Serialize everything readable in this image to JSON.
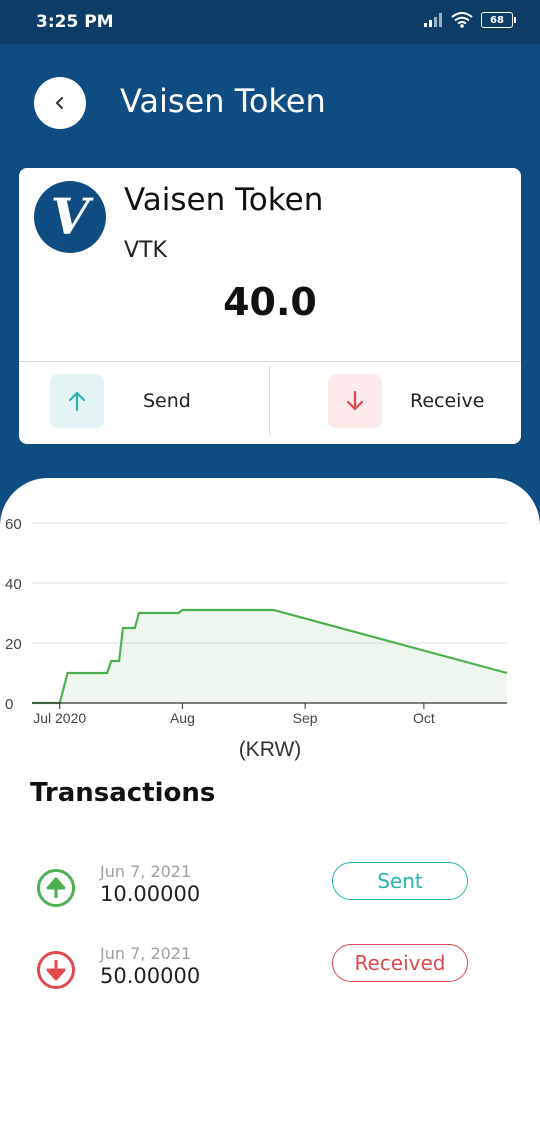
{
  "status_bar": {
    "time": "3:25 PM",
    "battery": "68"
  },
  "header": {
    "title": "Vaisen Token"
  },
  "token": {
    "logo_letter": "V",
    "name": "Vaisen Token",
    "symbol": "VTK",
    "balance": "40.0"
  },
  "actions": {
    "send_label": "Send",
    "receive_label": "Receive"
  },
  "colors": {
    "header_bg": "#0f4c81",
    "send_accent": "#26b5b0",
    "receive_accent": "#e0494f",
    "line": "#4caf50"
  },
  "chart_data": {
    "type": "area",
    "x": [
      "2020-06-24",
      "2020-07-01",
      "2020-07-03",
      "2020-07-05",
      "2020-07-13",
      "2020-07-14",
      "2020-07-16",
      "2020-07-17",
      "2020-07-20",
      "2020-07-21",
      "2020-07-31",
      "2020-08-01",
      "2020-08-24",
      "2020-10-22"
    ],
    "values": [
      0,
      0,
      10,
      10,
      10,
      14,
      14,
      25,
      25,
      30,
      30,
      31,
      31,
      10
    ],
    "xlim": [
      "2020-06-24",
      "2020-10-22"
    ],
    "x_ticks": [
      "Jul 2020",
      "Aug",
      "Sep",
      "Oct"
    ],
    "x_tick_dates": [
      "2020-07-01",
      "2020-08-01",
      "2020-09-01",
      "2020-10-01"
    ],
    "ylim": [
      0,
      60
    ],
    "y_ticks": [
      0,
      20,
      40,
      60
    ],
    "xlabel": "(KRW)",
    "ylabel": "",
    "grid": true
  },
  "transactions": {
    "title": "Transactions",
    "items": [
      {
        "date": "Jun 7, 2021",
        "amount": "10.00000",
        "type": "Sent",
        "direction": "up-arrow-icon"
      },
      {
        "date": "Jun 7, 2021",
        "amount": "50.00000",
        "type": "Received",
        "direction": "down-arrow-icon"
      }
    ]
  }
}
